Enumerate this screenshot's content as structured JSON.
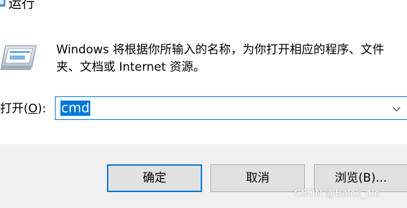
{
  "window": {
    "title": "运行",
    "title_icon": "run-dialog-icon"
  },
  "content": {
    "icon": "run-window-icon",
    "description_line1": "Windows 将根据你所输入的名称，为你打开相应的程序、文件",
    "description_line2": "夹、文档或 Internet 资源。"
  },
  "open_field": {
    "label_prefix": "打开(",
    "label_accel": "O",
    "label_suffix": "):",
    "value": "cmd",
    "dropdown_icon": "chevron-down-icon"
  },
  "buttons": {
    "ok": "确定",
    "cancel": "取消",
    "browse": "浏览(B)..."
  },
  "watermark": {
    "text": "CSDN @Balck_clo"
  },
  "colors": {
    "accent": "#0078d7",
    "button_bar": "#f0f0f0",
    "button_face": "#e1e1e1",
    "button_border": "#adadad"
  }
}
